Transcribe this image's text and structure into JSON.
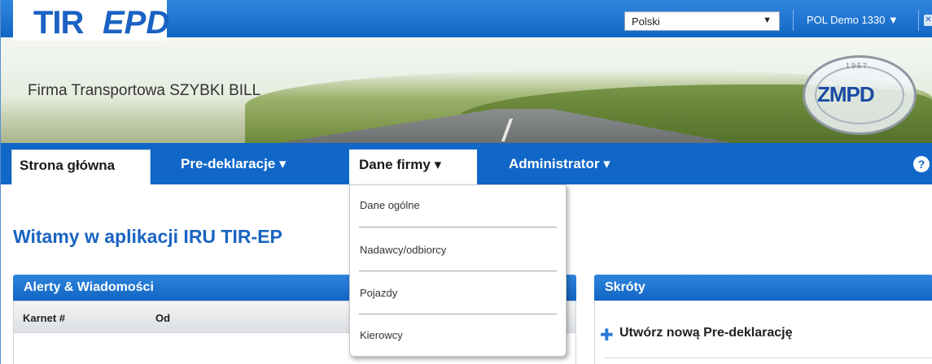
{
  "header": {
    "logo_tir": "TIR",
    "logo_epd": "EPD",
    "language": "Polski",
    "user": "POL Demo 1330",
    "company": "Firma Transportowa SZYBKI BILL",
    "zmpd_year": "1957",
    "zmpd_text": "ZMPD"
  },
  "nav": {
    "items": [
      {
        "label": "Strona główna"
      },
      {
        "label": "Pre-deklaracje ▾"
      },
      {
        "label": "Dane firmy ▾"
      },
      {
        "label": "Administrator ▾"
      }
    ],
    "help": "?"
  },
  "dropdown": {
    "items": [
      "Dane ogólne",
      "Nadawcy/odbiorcy",
      "Pojazdy",
      "Kierowcy"
    ]
  },
  "main": {
    "welcome": "Witamy w aplikacji IRU TIR-EP",
    "alerts": {
      "title": "Alerty & Wiadomości",
      "columns": [
        "Karnet #",
        "Od"
      ]
    },
    "shortcuts": {
      "title": "Skróty",
      "items": [
        "Utwórz nową Pre-deklarację"
      ]
    }
  },
  "colors": {
    "primary": "#1167c7",
    "title_blue": "#1a64c2"
  }
}
